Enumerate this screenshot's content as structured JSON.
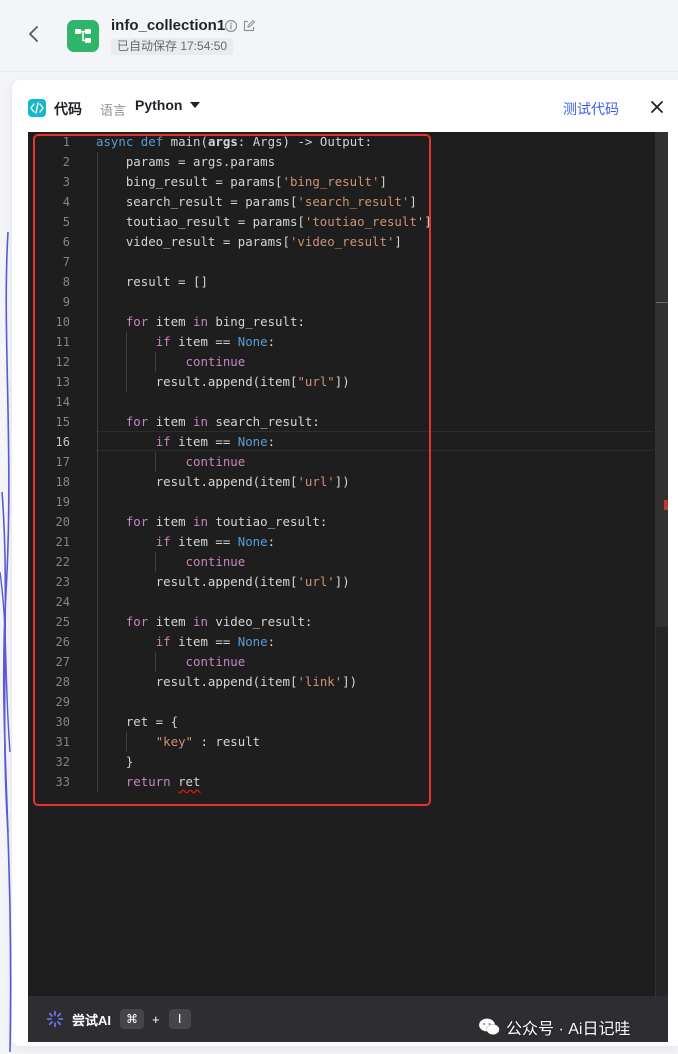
{
  "header": {
    "title": "info_collection1",
    "save_status": "已自动保存 17:54:50"
  },
  "panel": {
    "title": "代码",
    "language_label": "语言",
    "language_value": "Python",
    "test_button": "测试代码"
  },
  "editor": {
    "active_line": 16,
    "lines": [
      {
        "n": "1"
      },
      {
        "n": "2"
      },
      {
        "n": "3"
      },
      {
        "n": "4"
      },
      {
        "n": "5"
      },
      {
        "n": "6"
      },
      {
        "n": "7"
      },
      {
        "n": "8"
      },
      {
        "n": "9"
      },
      {
        "n": "10"
      },
      {
        "n": "11"
      },
      {
        "n": "12"
      },
      {
        "n": "13"
      },
      {
        "n": "14"
      },
      {
        "n": "15"
      },
      {
        "n": "16"
      },
      {
        "n": "17"
      },
      {
        "n": "18"
      },
      {
        "n": "19"
      },
      {
        "n": "20"
      },
      {
        "n": "21"
      },
      {
        "n": "22"
      },
      {
        "n": "23"
      },
      {
        "n": "24"
      },
      {
        "n": "25"
      },
      {
        "n": "26"
      },
      {
        "n": "27"
      },
      {
        "n": "28"
      },
      {
        "n": "29"
      },
      {
        "n": "30"
      },
      {
        "n": "31"
      },
      {
        "n": "32"
      },
      {
        "n": "33"
      }
    ],
    "code": {
      "l1_async": "async",
      "l1_def": "def",
      "l1_name": "main(",
      "l1_param": "args",
      "l1_rest": ": Args) -> Output:",
      "l2": "params = args.params",
      "l3_pre": "bing_result = params[",
      "l3_str": "'bing_result'",
      "l3_post": "]",
      "l4_pre": "search_result = params[",
      "l4_str": "'search_result'",
      "l4_post": "]",
      "l5_pre": "toutiao_result = params[",
      "l5_str": "'toutiao_result'",
      "l5_post": "]",
      "l6_pre": "video_result = params[",
      "l6_str": "'video_result'",
      "l6_post": "]",
      "l8": "result = []",
      "for": "for",
      "in": "in",
      "if": "if",
      "continue": "continue",
      "none": "None",
      "item": " item ",
      "eq": " item == ",
      "colon": ":",
      "l10_rest": " bing_result:",
      "l13_pre": "result.append(item[",
      "l13_str": "\"url\"",
      "l13_post": "])",
      "l15_rest": " search_result:",
      "l18_pre": "result.append(item[",
      "l18_str": "'url'",
      "l18_post": "])",
      "l20_rest": " toutiao_result:",
      "l23_pre": "result.append(item[",
      "l23_str": "'url'",
      "l23_post": "])",
      "l25_rest": " video_result:",
      "l28_pre": "result.append(item[",
      "l28_str": "'link'",
      "l28_post": "])",
      "l30": "ret = {",
      "l31_str": "\"key\"",
      "l31_rest": " : result",
      "l32": "}",
      "l33_kw": "return",
      "l33_val": "ret"
    }
  },
  "ai_bar": {
    "label": "尝试AI",
    "key1": "⌘",
    "plus": "+",
    "key2": "I"
  },
  "watermark": "公众号 · Ai日记哇",
  "colors": {
    "editor_bg": "#1e1e1e",
    "keyword": "#569cd6",
    "control": "#c586c0",
    "string": "#ce9178",
    "accent": "#3c5cf0",
    "highlight_border": "#e8322b",
    "app_icon": "#2fb46c"
  },
  "icons": [
    "back-arrow-icon",
    "workflow-app-icon",
    "info-icon",
    "edit-icon",
    "code-icon",
    "caret-down-icon",
    "close-icon",
    "ai-sparkle-icon",
    "wechat-icon"
  ]
}
